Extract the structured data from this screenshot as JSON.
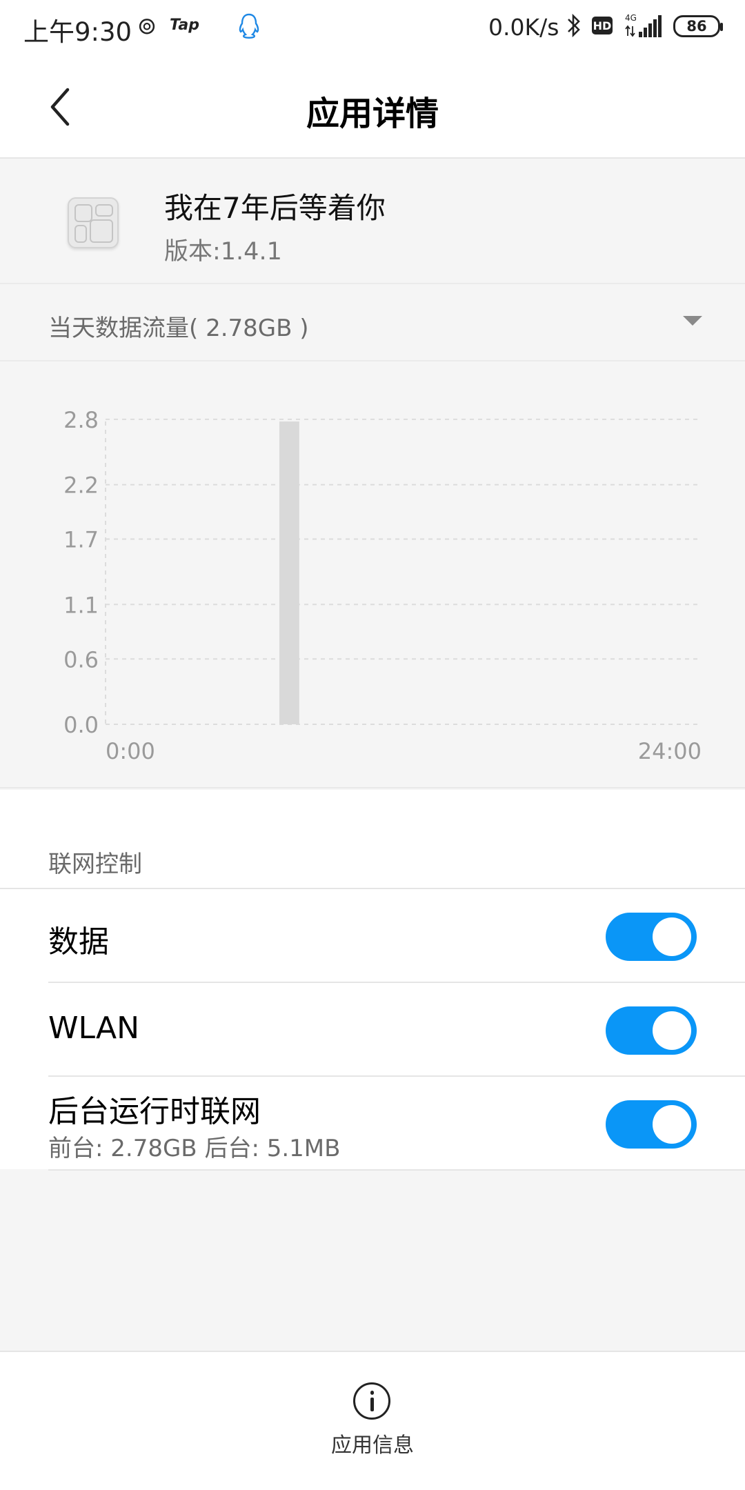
{
  "status_bar": {
    "time": "上午9:30",
    "tap_label": "Tap",
    "net_speed": "0.0K/s",
    "hd_label": "HD",
    "network_type": "4G",
    "battery_level": "86"
  },
  "header": {
    "title": "应用详情"
  },
  "app": {
    "name": "我在7年后等着你",
    "version": "版本:1.4.1"
  },
  "traffic": {
    "period_label": "当天数据流量( 2.78GB )"
  },
  "chart_data": {
    "type": "bar",
    "title": "",
    "xlabel": "",
    "ylabel": "",
    "x_tick_labels": [
      "0:00",
      "24:00"
    ],
    "y_ticks": [
      "0.0",
      "0.6",
      "1.1",
      "1.7",
      "2.2",
      "2.8"
    ],
    "ylim": [
      0,
      2.78
    ],
    "xlim": [
      0,
      24
    ],
    "grid": true,
    "bars": [
      {
        "x_start": 7.0,
        "x_end": 7.8,
        "value": 2.78
      }
    ],
    "colors": {
      "bar": "#d9d9d9",
      "grid": "#dcdcdc",
      "tick_text": "#9a9a9a"
    }
  },
  "network_control": {
    "section_title": "联网控制",
    "rows": [
      {
        "label": "数据",
        "enabled": true
      },
      {
        "label": "WLAN",
        "enabled": true
      },
      {
        "label": "后台运行时联网",
        "sublabel": "前台: 2.78GB  后台: 5.1MB",
        "enabled": true
      }
    ]
  },
  "bottom": {
    "label": "应用信息"
  },
  "colors": {
    "accent": "#0a96f7",
    "background": "#f5f5f5"
  }
}
